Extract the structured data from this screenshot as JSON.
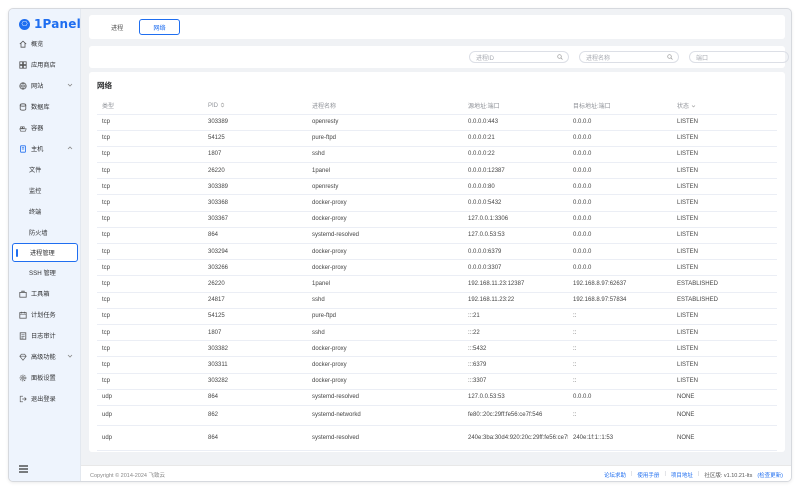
{
  "app": {
    "logo_text": "1Panel"
  },
  "sidebar": {
    "items": [
      {
        "label": "概览",
        "icon": "home-icon"
      },
      {
        "label": "应用商店",
        "icon": "store-icon"
      },
      {
        "label": "网站",
        "icon": "globe-icon"
      },
      {
        "label": "数据库",
        "icon": "database-icon"
      },
      {
        "label": "容器",
        "icon": "container-icon"
      },
      {
        "label": "主机",
        "icon": "host-icon"
      },
      {
        "label": "文件"
      },
      {
        "label": "监控"
      },
      {
        "label": "终端"
      },
      {
        "label": "防火墙"
      },
      {
        "label": "进程管理"
      },
      {
        "label": "SSH 管理"
      },
      {
        "label": "工具箱",
        "icon": "toolbox-icon"
      },
      {
        "label": "计划任务",
        "icon": "calendar-icon"
      },
      {
        "label": "日志审计",
        "icon": "log-icon"
      },
      {
        "label": "高级功能",
        "icon": "diamond-icon"
      },
      {
        "label": "面板设置",
        "icon": "gear-icon"
      },
      {
        "label": "退出登录",
        "icon": "logout-icon"
      }
    ]
  },
  "tabs": {
    "process": "进程",
    "network": "网络"
  },
  "filters": {
    "pid_placeholder": "进程ID",
    "name_placeholder": "进程名称",
    "port_placeholder": "端口"
  },
  "panel": {
    "title": "网络",
    "columns": [
      "类型",
      "PID",
      "进程名称",
      "源地址:端口",
      "目标地址:端口",
      "状态"
    ],
    "rows": [
      [
        "tcp",
        "303389",
        "openresty",
        "0.0.0.0:443",
        "0.0.0.0",
        "LISTEN"
      ],
      [
        "tcp",
        "54125",
        "pure-ftpd",
        "0.0.0.0:21",
        "0.0.0.0",
        "LISTEN"
      ],
      [
        "tcp",
        "1807",
        "sshd",
        "0.0.0.0:22",
        "0.0.0.0",
        "LISTEN"
      ],
      [
        "tcp",
        "26220",
        "1panel",
        "0.0.0.0:12387",
        "0.0.0.0",
        "LISTEN"
      ],
      [
        "tcp",
        "303389",
        "openresty",
        "0.0.0.0:80",
        "0.0.0.0",
        "LISTEN"
      ],
      [
        "tcp",
        "303368",
        "docker-proxy",
        "0.0.0.0:5432",
        "0.0.0.0",
        "LISTEN"
      ],
      [
        "tcp",
        "303367",
        "docker-proxy",
        "127.0.0.1:3306",
        "0.0.0.0",
        "LISTEN"
      ],
      [
        "tcp",
        "864",
        "systemd-resolved",
        "127.0.0.53:53",
        "0.0.0.0",
        "LISTEN"
      ],
      [
        "tcp",
        "303294",
        "docker-proxy",
        "0.0.0.0:6379",
        "0.0.0.0",
        "LISTEN"
      ],
      [
        "tcp",
        "303266",
        "docker-proxy",
        "0.0.0.0:3307",
        "0.0.0.0",
        "LISTEN"
      ],
      [
        "tcp",
        "26220",
        "1panel",
        "192.168.11.23:12387",
        "192.168.8.97:62637",
        "ESTABLISHED"
      ],
      [
        "tcp",
        "24817",
        "sshd",
        "192.168.11.23:22",
        "192.168.8.97:57834",
        "ESTABLISHED"
      ],
      [
        "tcp",
        "54125",
        "pure-ftpd",
        ":::21",
        "::",
        "LISTEN"
      ],
      [
        "tcp",
        "1807",
        "sshd",
        ":::22",
        "::",
        "LISTEN"
      ],
      [
        "tcp",
        "303382",
        "docker-proxy",
        ":::5432",
        "::",
        "LISTEN"
      ],
      [
        "tcp",
        "303311",
        "docker-proxy",
        ":::6379",
        "::",
        "LISTEN"
      ],
      [
        "tcp",
        "303282",
        "docker-proxy",
        ":::3307",
        "::",
        "LISTEN"
      ],
      [
        "udp",
        "864",
        "systemd-resolved",
        "127.0.0.53:53",
        "0.0.0.0",
        "NONE"
      ],
      [
        "udp",
        "862",
        "systemd-networkd",
        "fe80::20c:29ff:fe56:ce7f:546",
        "::",
        "NONE"
      ],
      [
        "udp",
        "864",
        "systemd-resolved",
        "240e:3ba:30d4:920:20c:29ff:fe56:ce7f:38004",
        "240e:1f:1::1:53",
        "NONE"
      ]
    ]
  },
  "footer": {
    "copyright": "Copyright © 2014-2024 飞致云",
    "links": [
      "论坛求助",
      "使用手册",
      "项目地址"
    ],
    "version": "社区版: v1.10.21-lts",
    "update": "(检查更新)"
  },
  "colors": {
    "accent": "#1f6ef0",
    "sidebar_bg": "#eef4fd",
    "page_bg": "#f0f2f5"
  }
}
